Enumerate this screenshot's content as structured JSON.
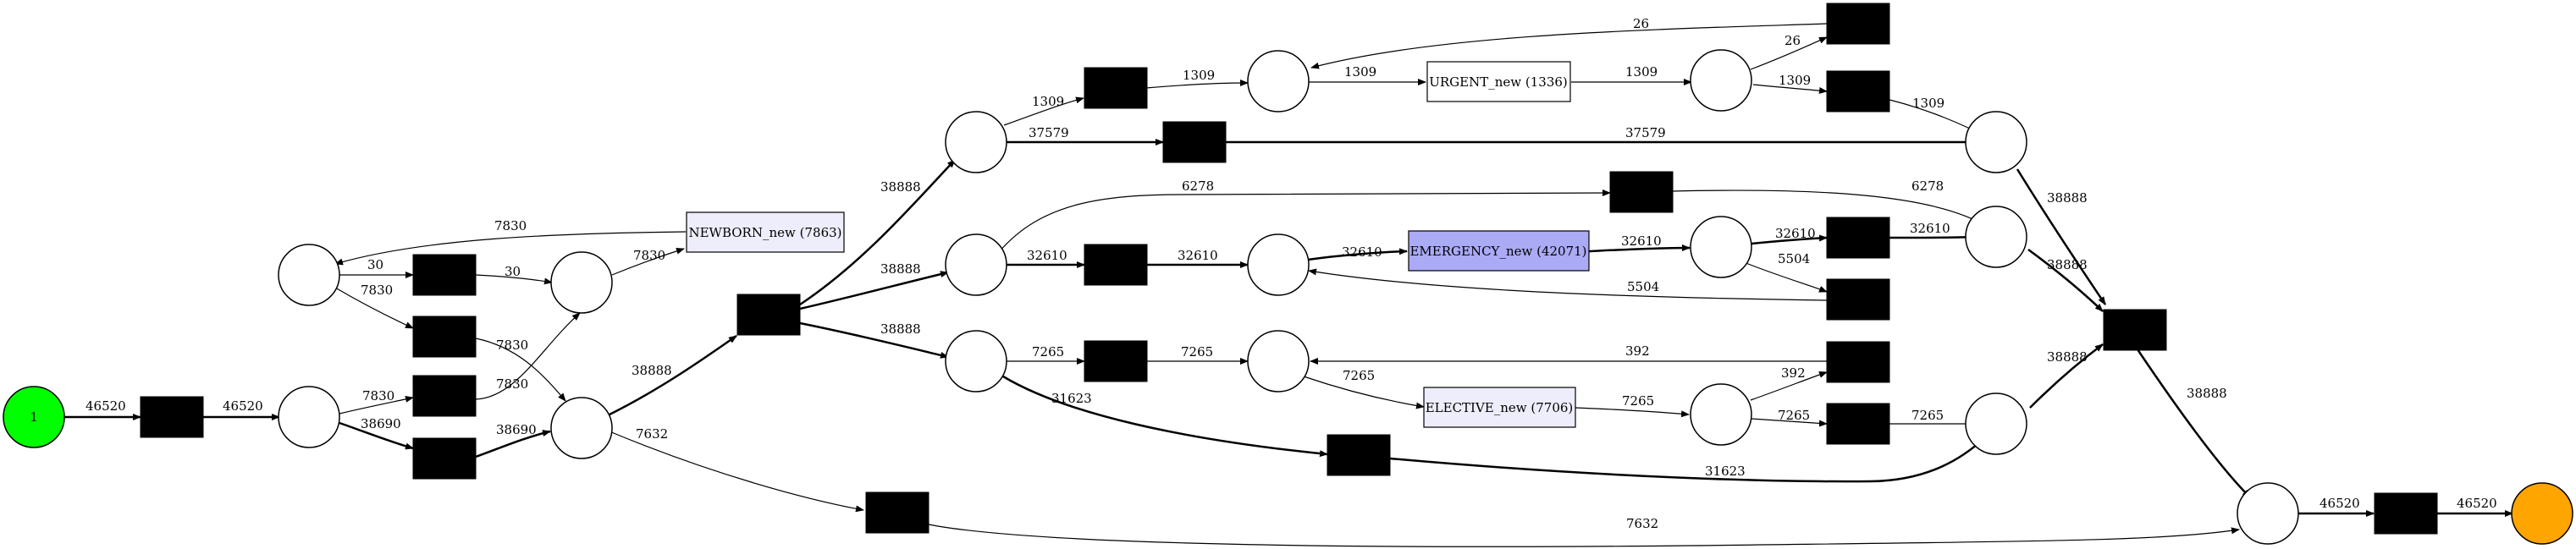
{
  "diagram": {
    "type": "petri-net",
    "colors": {
      "start_place": "#00ff00",
      "end_place": "#ffa500",
      "activity_default": "#ededfb",
      "activity_high": "#aaaaf5",
      "activity_low": "#ffffff",
      "silent_transition": "#000000"
    },
    "start_token": "1",
    "activities": {
      "newborn": "NEWBORN_new (7863)",
      "urgent": "URGENT_new (1336)",
      "emergency": "EMERGENCY_new (42071)",
      "elective": "ELECTIVE_new (7706)"
    },
    "edge_labels": {
      "start_t1": "46520",
      "t1_p1": "46520",
      "p1_tA": "7830",
      "p1_tB": "38690",
      "tB_p4": "38690",
      "tA_p3": "7830",
      "newborn_p2": "7830",
      "p2_t30": "30",
      "p2_t7830": "7830",
      "t30_p3": "30",
      "t7830_p4": "7830",
      "p3_newborn": "7830",
      "p4_split": "38888",
      "p4_skip": "7632",
      "skip_end": "7632",
      "split_pU": "38888",
      "split_pE": "38888",
      "split_pL": "38888",
      "pU_tU": "1309",
      "tU_pU2": "1309",
      "pU2_urgent": "1309",
      "urgent_pU3": "1309",
      "pU3_tLoop": "26",
      "tLoop_pU2": "26",
      "pU3_tOut": "1309",
      "tOut_pUend": "1309",
      "pU_skip": "37579",
      "skip_pUend": "37579",
      "pE_skip": "6278",
      "skipE_pEend": "6278",
      "pE_tE": "32610",
      "tE_pE2": "32610",
      "pE2_emergency": "32610",
      "emergency_pE3": "32610",
      "pE3_tOut": "32610",
      "tOut_pEend": "32610",
      "pE3_loop": "5504",
      "loop_pE2": "5504",
      "pL_tL": "7265",
      "tL_pL2": "7265",
      "pL2_elective": "7265",
      "elective_pL3": "7265",
      "pL3_loop": "392",
      "loop_pL2": "392",
      "pL3_tOut": "7265",
      "tOut_pLend": "7265",
      "pL_skip": "31623",
      "skipL_pLend": "31623",
      "pUend_join": "38888",
      "pEend_join": "38888",
      "pLend_join": "38888",
      "join_pF": "38888",
      "pF_tEnd": "46520",
      "tEnd_end": "46520"
    }
  }
}
